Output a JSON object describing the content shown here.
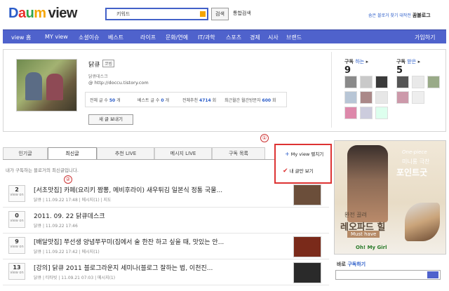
{
  "header": {
    "logo": "Daum view",
    "search_value": "키워드",
    "search_button": "검색",
    "unified_search": "통합검색",
    "tagline_prefix": "숨은 블로거 찾기 대작전",
    "tagline_bold": "꿈블로그"
  },
  "nav": {
    "items": [
      "view 홈",
      "MY view",
      "소셜이슈",
      "베스트",
      "라이프",
      "문화/연예",
      "IT/과학",
      "스포츠",
      "경제",
      "시사",
      "브랜드"
    ],
    "login": "가입하기"
  },
  "profile": {
    "name": "닭큐",
    "badge": "코빔",
    "desc": "닭큐데스크",
    "url": "@ http://doccu.tistory.com",
    "stats": [
      {
        "label": "전체 글 수",
        "value": "50",
        "unit": "개"
      },
      {
        "label": "베스트 글 수",
        "value": "0",
        "unit": "개"
      },
      {
        "label": "전체추천",
        "value": "4714",
        "unit": "회"
      },
      {
        "label": "최근월간 월간방문자",
        "value": "600",
        "unit": "회"
      }
    ],
    "send_button": "새 글 보내기",
    "subscribing": {
      "label": "구독",
      "link": "하는",
      "count": "9"
    },
    "subscribers": {
      "label": "구독",
      "link": "받은",
      "count": "5"
    }
  },
  "tabs": [
    "인기글",
    "최신글",
    "추천 LIVE",
    "메시지 LIVE",
    "구독 목록"
  ],
  "active_tab": 1,
  "sub_info": "내가 구독하는 블로거의 최신글입니다.",
  "dropdown": {
    "option1": "My view 펼치기",
    "option2": "내 글만 보기"
  },
  "annotations": [
    "①",
    "②"
  ],
  "items": [
    {
      "count": "2",
      "title": "[서초맛집] 카페(요리키 짬뽕, 메비후라이) 새우튀김 일본식 정통 국물...",
      "meta": "닭큐 | 11.09.22 17:48 | 메시지(1) | 지도",
      "thumb": "#6b4e3a"
    },
    {
      "count": "0",
      "title": "2011. 09. 22 닭큐데스크",
      "meta": "닭큐 | 11.09.22 17:46",
      "thumb": ""
    },
    {
      "count": "9",
      "title": "[배달맛집] 쭈선생 양념쭈꾸미(집에서 술 한잔 하고 싶을 때, 맛있는 안...",
      "meta": "닭큐 | 11.09.22 17:42 | 메시지(1)",
      "thumb": "#7a2a1a"
    },
    {
      "count": "13",
      "title": "[강의] 닭큐 2011 블로그라운지 세미나(블로그 잘하는 법, 이천진...",
      "meta": "닭큐 | 티타빗 | 11.09.21 07:03 | 메시지(1)",
      "thumb": "#2a2a2a"
    }
  ],
  "ad": {
    "line1": "One-piece",
    "line2": "미니롱 극찬",
    "line3": "포인트굿",
    "line4": "완전 끌려",
    "line5": "레오파드 힐",
    "line6": "Must have",
    "brand": "Oh! My Girl"
  },
  "rss": {
    "title_prefix": "바로 ",
    "title_link": "구독하기",
    "placeholder": ""
  },
  "colors": {
    "nav_bg": "#4f62cc",
    "accent_blue": "#2a5cc9",
    "annotation_red": "#d33"
  }
}
